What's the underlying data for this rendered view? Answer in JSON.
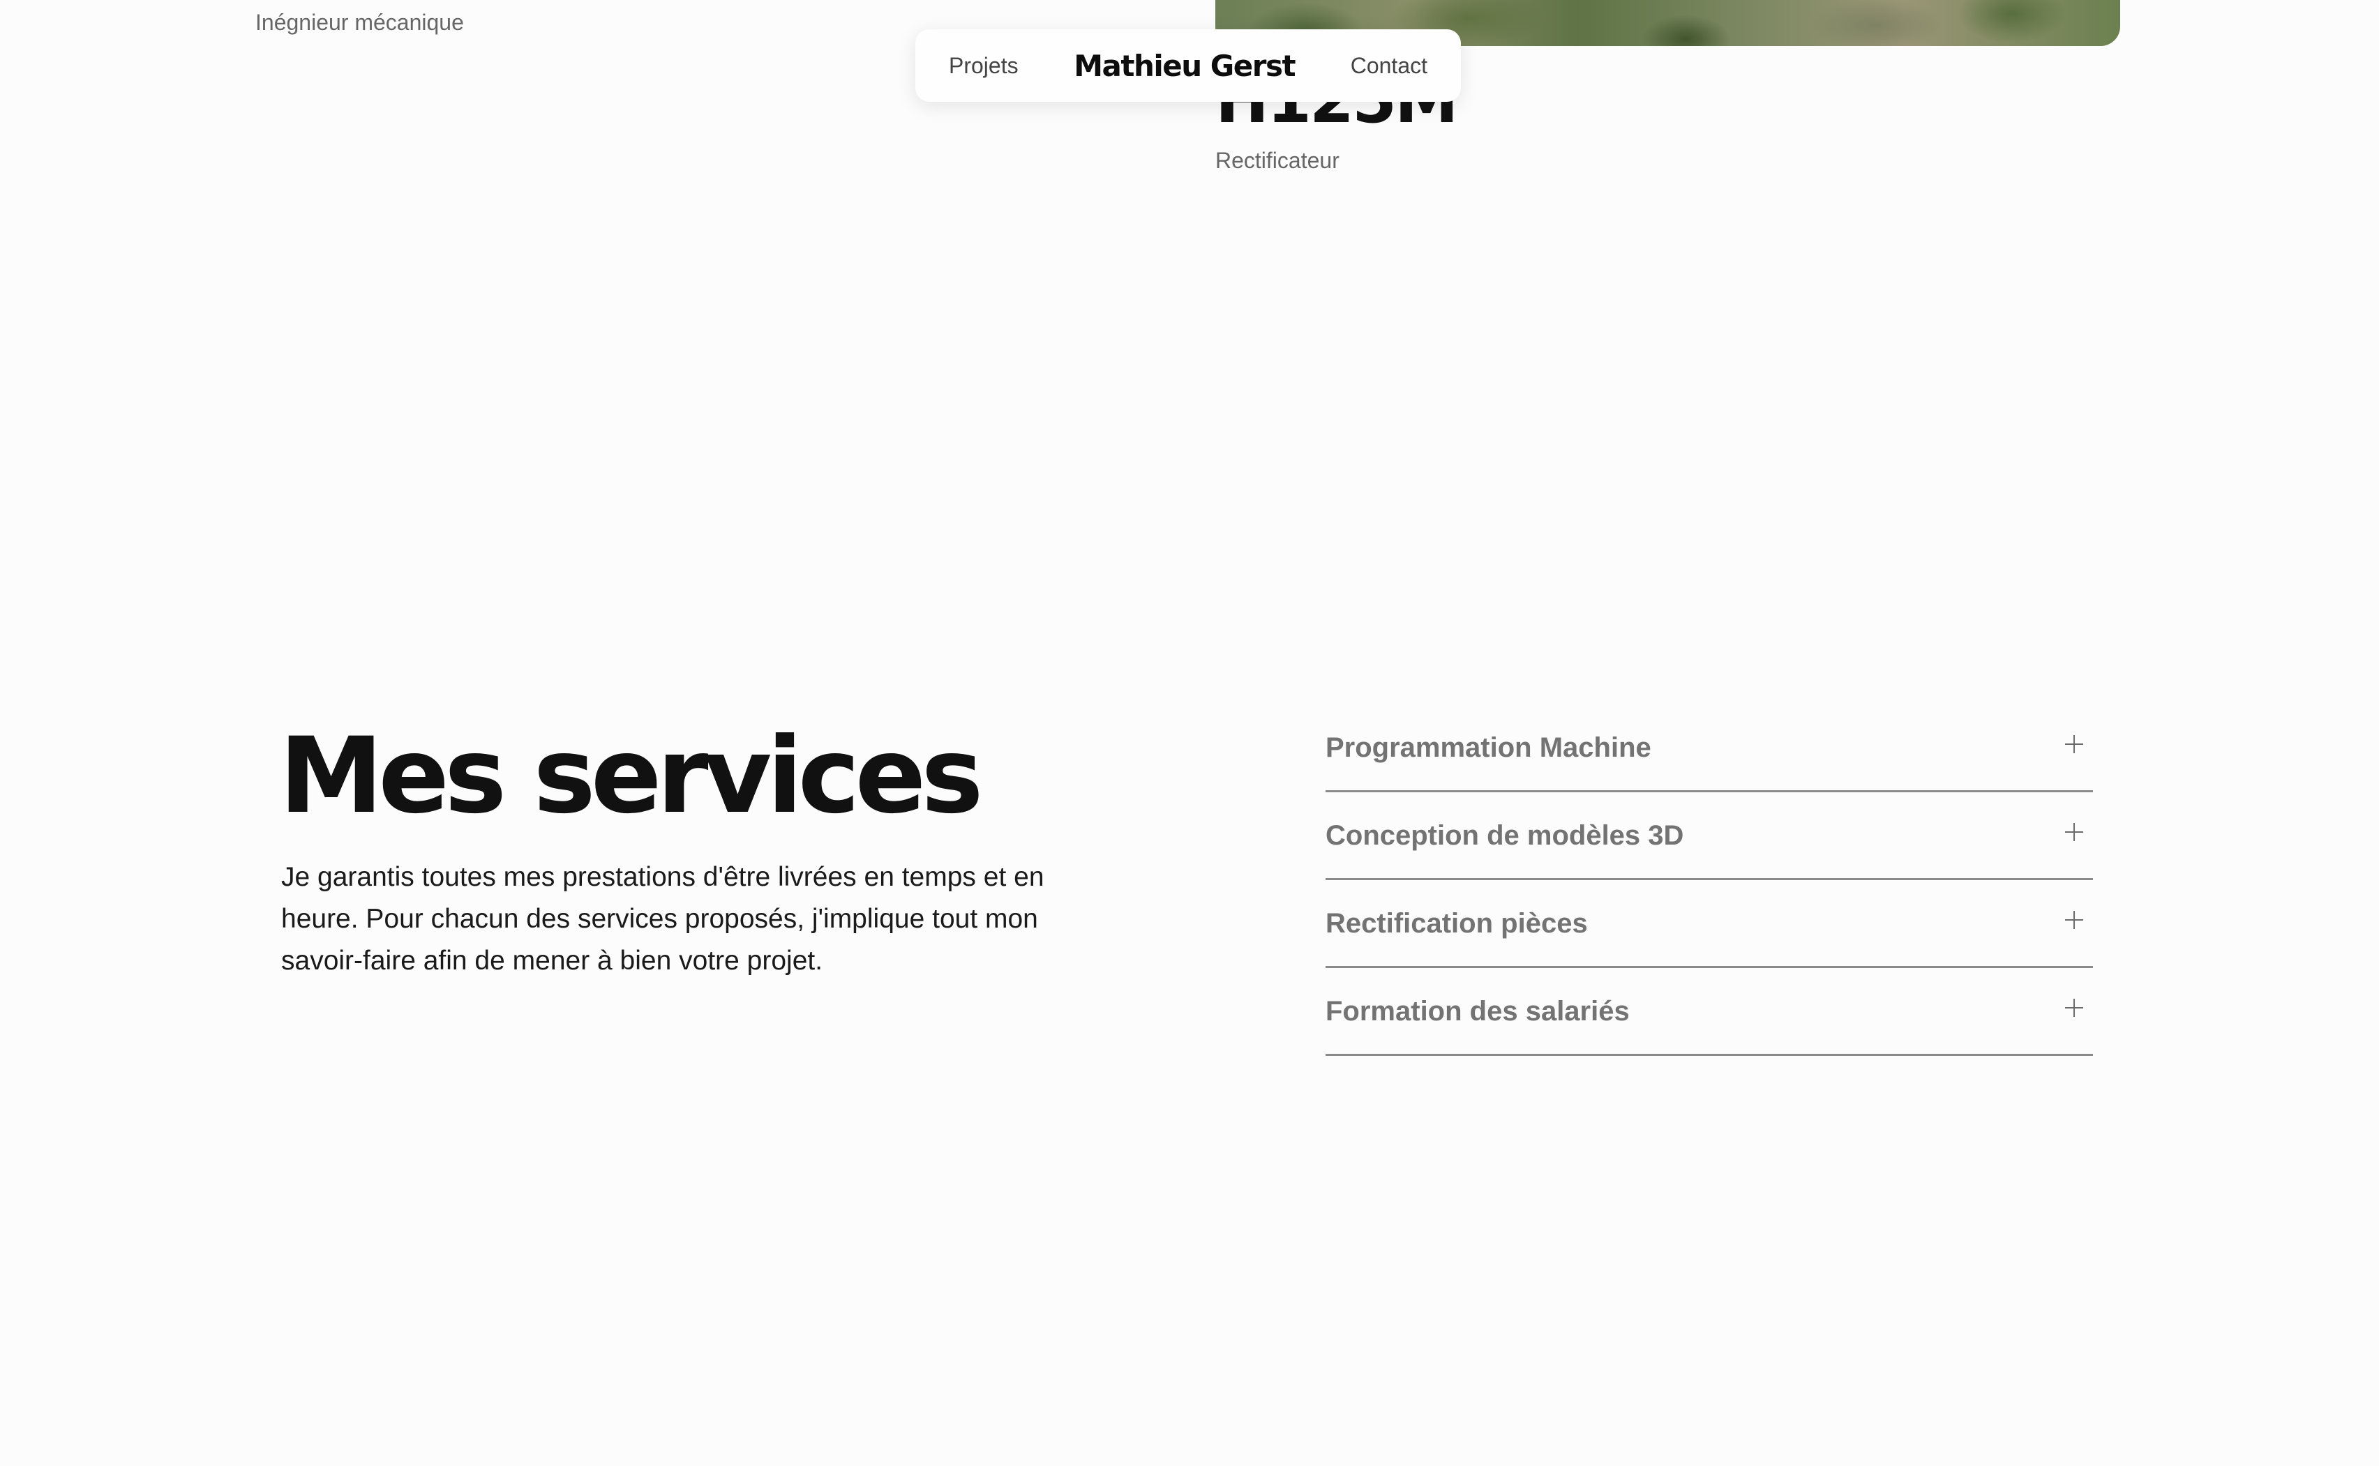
{
  "previous_project": {
    "left_caption": "Inégnieur mécanique",
    "title": "H125M",
    "subtitle": "Rectificateur"
  },
  "navbar": {
    "projects_label": "Projets",
    "brand": "Mathieu Gerst",
    "contact_label": "Contact"
  },
  "services": {
    "title": "Mes services",
    "description": "Je garantis toutes mes prestations d'être livrées en temps et en heure. Pour chacun des services proposés, j'implique tout mon savoir-faire afin de mener à bien votre projet.",
    "items": [
      {
        "label": "Programmation Machine",
        "icon": "plus-icon"
      },
      {
        "label": "Conception de modèles 3D",
        "icon": "plus-icon"
      },
      {
        "label": "Rectification pièces",
        "icon": "plus-icon"
      },
      {
        "label": "Formation des salariés",
        "icon": "plus-icon"
      }
    ]
  }
}
